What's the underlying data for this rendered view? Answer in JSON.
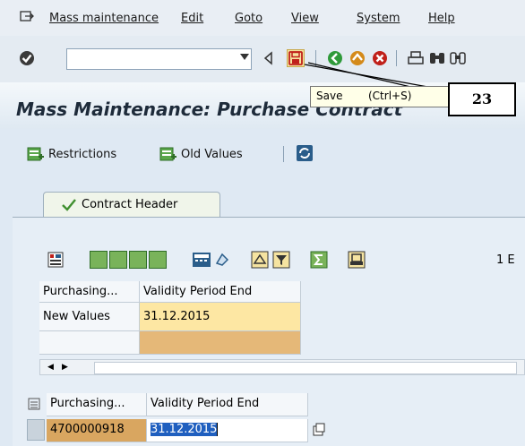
{
  "menu": {
    "items": [
      "Mass maintenance",
      "Edit",
      "Goto",
      "View",
      "System",
      "Help"
    ]
  },
  "toolbar": {
    "command_value": "",
    "tooltip_text": "Save",
    "tooltip_shortcut": "(Ctrl+S)",
    "callout_number": "23"
  },
  "title": "Mass Maintenance: Purchase Contract",
  "app_toolbar": {
    "restrictions": "Restrictions",
    "old_values": "Old Values"
  },
  "tab": {
    "label": "Contract Header"
  },
  "grid": {
    "count_text": "1 E",
    "table1": {
      "columns": [
        "Purchasing...",
        "Validity Period End"
      ],
      "rows": [
        {
          "label": "New Values",
          "value": "31.12.2015"
        },
        {
          "label": "",
          "value": ""
        }
      ]
    },
    "table2": {
      "columns": [
        "Purchasing...",
        "Validity Period End"
      ],
      "rows": [
        {
          "doc": "4700000918",
          "value": "31.12.2015"
        }
      ]
    }
  },
  "colors": {
    "accent_green": "#3f8f2f",
    "save_red": "#c0201a",
    "highlight_yellow": "#fde7a3",
    "highlight_orange": "#e5b878"
  }
}
